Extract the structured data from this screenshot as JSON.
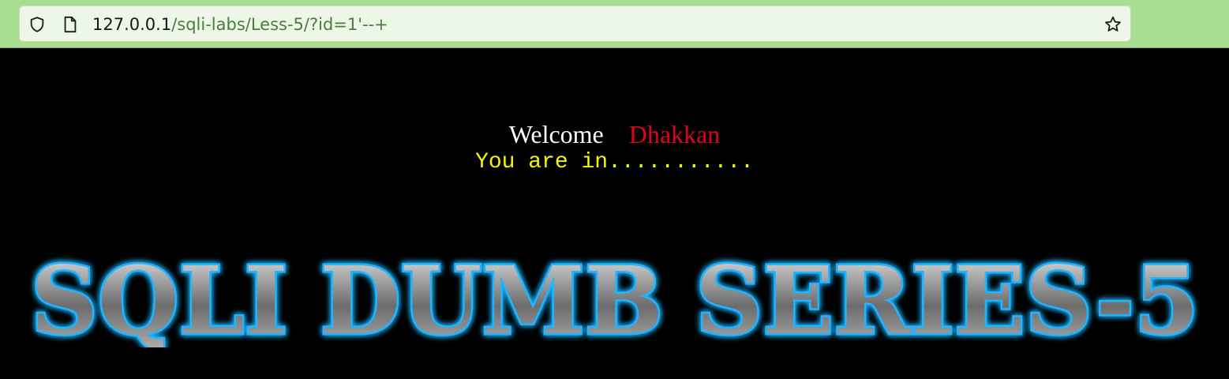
{
  "browser": {
    "url_host": "127.0.0.1",
    "url_path": "/sqli-labs/Less-5/?id=1'--+",
    "icons": [
      "shield-icon",
      "page-icon",
      "star-icon"
    ],
    "colors": {
      "toolbar": "#a9dd8f",
      "urlbar": "#edf7e8"
    }
  },
  "page": {
    "welcome_label": "Welcome",
    "user_name": "Dhakkan",
    "status_message": "You are in...........",
    "banner_text": "SQLI DUMB SERIES-5",
    "colors": {
      "background": "#000000",
      "welcome": "#ffffff",
      "name": "#e2001a",
      "status": "#f5f500",
      "banner_glow": "#1ea9f0"
    }
  }
}
